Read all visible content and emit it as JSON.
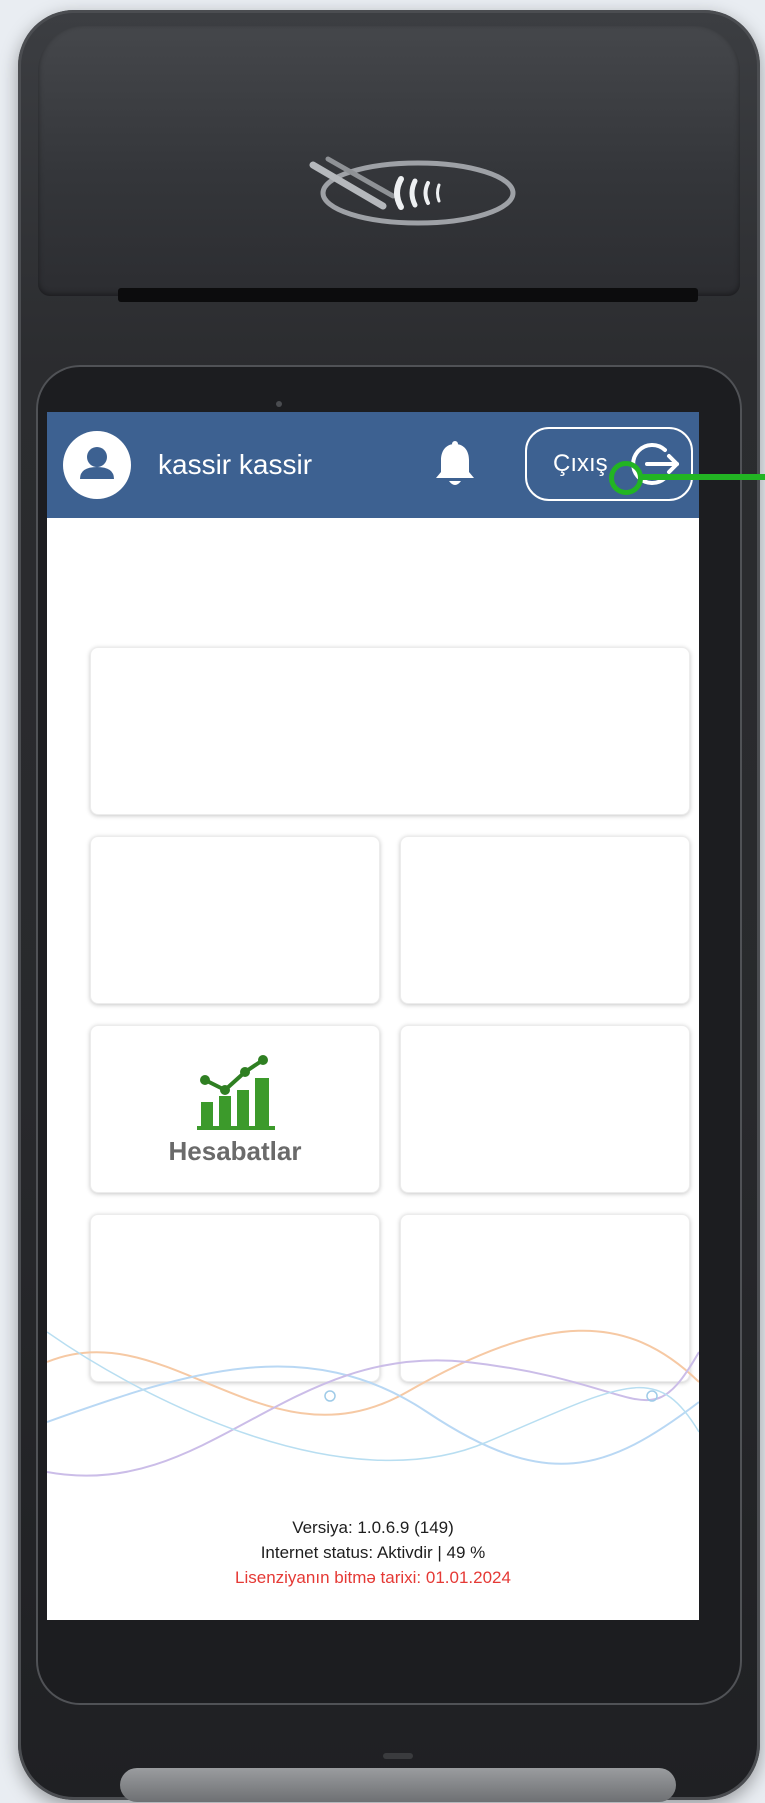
{
  "header": {
    "username": "kassir kassir",
    "logout_label": "Çıxış"
  },
  "tiles": {
    "reports_label": "Hesabatlar"
  },
  "footer": {
    "version": "Versiya: 1.0.6.9 (149)",
    "internet_status": "Internet status: Aktivdir | 49 %",
    "license_expiry": "Lisenziyanın bitmə tarixi: 01.01.2024"
  },
  "icons": {
    "avatar": "user-icon",
    "notifications": "bell-icon",
    "logout": "logout-icon",
    "reports": "chart-icon"
  },
  "colors": {
    "header_background": "#3d6191",
    "reports_icon": "#3c9a2b",
    "license_text": "#e53935",
    "annotation": "#22b423"
  }
}
